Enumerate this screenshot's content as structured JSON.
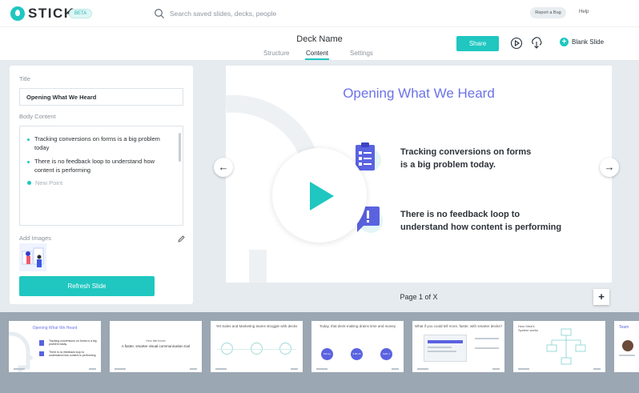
{
  "header": {
    "brand": "STICK",
    "beta": "BETA",
    "search_placeholder": "Search saved slides, decks, people",
    "report_bug": "Report a Bug",
    "help": "Help"
  },
  "deck": {
    "name": "Deck Name",
    "tabs": [
      "Structure",
      "Content",
      "Settings"
    ],
    "active_tab": "Content",
    "share": "Share",
    "blank_slide": "Blank Slide"
  },
  "editor": {
    "title_label": "Title",
    "title_value": "Opening What We Heard",
    "body_label": "Body Content",
    "bullets": [
      "Tracking conversions on forms is a big problem today",
      "There is no feedback loop to understand how content is performing"
    ],
    "new_point_placeholder": "New Point",
    "images_label": "Add Images",
    "refresh": "Refresh Slide"
  },
  "slide": {
    "title": "Opening What We Heard",
    "point1_line1": "Tracking conversions on forms",
    "point1_line2": "is a big problem today.",
    "point2_line1": "There is no feedback loop to",
    "point2_line2": "understand how content is performing"
  },
  "pager": {
    "label": "Page 1 of X"
  },
  "thumbnails": {
    "t1": {
      "title": "Opening What We Heard",
      "p1": "Tracking conversions on forms is a big problem today.",
      "p2": "There is no feedback loop to understand how content is performing"
    },
    "t2": {
      "kicker": "Hero title boxes",
      "title": "A faster, smarter visual communication tool"
    },
    "t3": {
      "title": "Yet Sales and Marketing teams struggle with decks"
    },
    "t4": {
      "title": "Today, that deck-making drains time and money",
      "c1": "Money",
      "c2": "$ 80.4b",
      "c3": "Sells 1 Budget"
    },
    "t5": {
      "title": "What if you could tell more, faster, with smarter decks?"
    },
    "t6": {
      "title": "How Stick's System works"
    },
    "t7": {
      "title": "Team"
    }
  },
  "colors": {
    "accent": "#1fc7c0",
    "slide_title": "#6b73e8",
    "strip": "#9ba7b2",
    "icon_purple": "#5a62e0"
  }
}
